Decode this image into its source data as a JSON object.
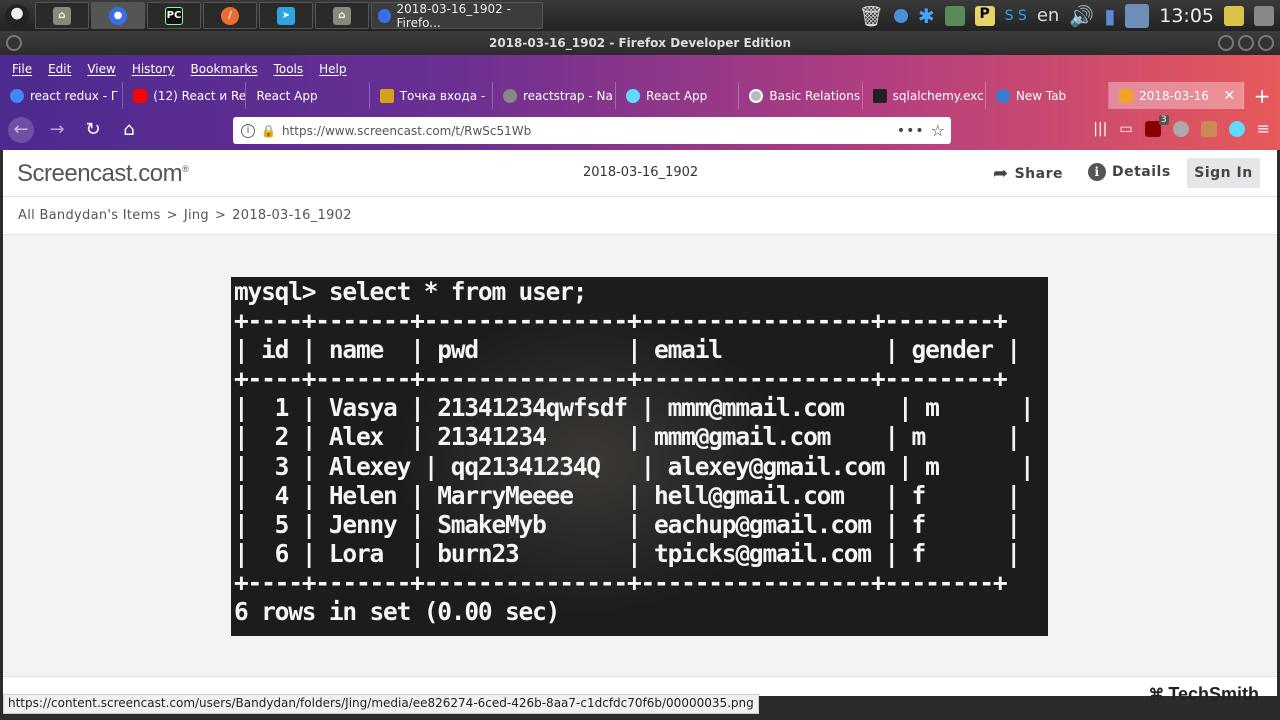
{
  "taskbar": {
    "window_title": "2018-03-16_1902 - Firefo...",
    "lang": "en",
    "clock": "13:05"
  },
  "window": {
    "title": "2018-03-16_1902 - Firefox Developer Edition"
  },
  "menu": [
    "File",
    "Edit",
    "View",
    "History",
    "Bookmarks",
    "Tools",
    "Help"
  ],
  "tabs": [
    {
      "label": "react redux - Г",
      "color": "#4285f4"
    },
    {
      "label": "(12) React и Re",
      "color": "#ff0000"
    },
    {
      "label": "React App",
      "color": ""
    },
    {
      "label": "Точка входа -",
      "color": "#d4a017"
    },
    {
      "label": "reactstrap - Na",
      "color": "#888888"
    },
    {
      "label": "React App",
      "color": "#61dafb"
    },
    {
      "label": "Basic Relations",
      "color": "#bbbbbb"
    },
    {
      "label": "sqlalchemy.exc",
      "color": "#222222"
    },
    {
      "label": "New Tab",
      "color": "#3a7bd5"
    },
    {
      "label": "2018-03-16",
      "color": "#f4a12a",
      "active": true
    }
  ],
  "nav": {
    "url": "https://www.screencast.com/t/RwSc51Wb",
    "badge": "3"
  },
  "screencast": {
    "logo": "Screencast.com",
    "title": "2018-03-16_1902",
    "share": "Share",
    "details": "Details",
    "sign_in": "Sign In",
    "breadcrumb": [
      "All Bandydan's Items",
      "Jing",
      "2018-03-16_1902"
    ],
    "footer_brand": "TechSmith"
  },
  "terminal": {
    "command": "mysql> select * from user;",
    "border": "+----+-------+---------------+-----------------+--------+",
    "columns": [
      "id",
      "name",
      "pwd",
      "email",
      "gender"
    ],
    "rows": [
      [
        "1",
        "Vasya",
        "21341234qwfsdf",
        "mmm@mmail.com",
        "m"
      ],
      [
        "2",
        "Alex",
        "21341234",
        "mmm@gmail.com",
        "m"
      ],
      [
        "3",
        "Alexey",
        "qq21341234Q",
        "alexey@gmail.com",
        "m"
      ],
      [
        "4",
        "Helen",
        "MarryMeeee",
        "hell@gmail.com",
        "f"
      ],
      [
        "5",
        "Jenny",
        "SmakeMyb",
        "eachup@gmail.com",
        "f"
      ],
      [
        "6",
        "Lora",
        "burn23",
        "tpicks@gmail.com",
        "f"
      ]
    ],
    "summary": "6 rows in set (0.00 sec)"
  },
  "status_url": "https://content.screencast.com/users/Bandydan/folders/Jing/media/ee826274-6ced-426b-8aa7-c1dcfdc70f6b/00000035.png"
}
